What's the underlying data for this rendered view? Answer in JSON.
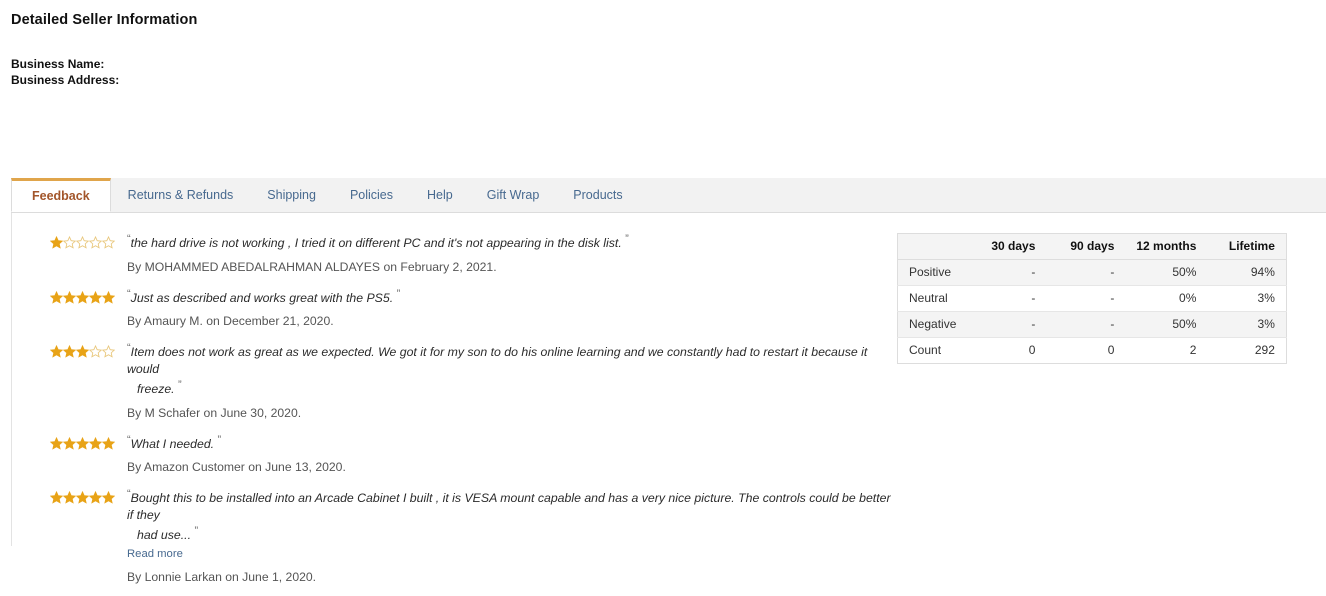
{
  "header": {
    "title": "Detailed Seller Information",
    "business_name_label": "Business Name:",
    "business_address_label": "Business Address:"
  },
  "tabs": [
    {
      "label": "Feedback",
      "active": true
    },
    {
      "label": "Returns & Refunds",
      "active": false
    },
    {
      "label": "Shipping",
      "active": false
    },
    {
      "label": "Policies",
      "active": false
    },
    {
      "label": "Help",
      "active": false
    },
    {
      "label": "Gift Wrap",
      "active": false
    },
    {
      "label": "Products",
      "active": false
    }
  ],
  "reviews": [
    {
      "rating": 1,
      "max_rating": 5,
      "quote_line1": "the hard drive is not working , I tried it on different PC and it's not appearing in the disk list.",
      "quote_line2": "",
      "read_more": "",
      "byline": "By MOHAMMED ABEDALRAHMAN ALDAYES on February 2, 2021."
    },
    {
      "rating": 5,
      "max_rating": 5,
      "quote_line1": "Just as described and works great with the PS5.",
      "quote_line2": "",
      "read_more": "",
      "byline": "By Amaury M. on December 21, 2020."
    },
    {
      "rating": 3,
      "max_rating": 5,
      "quote_line1": "Item does not work as great as we expected. We got it for my son to do his online learning and we constantly had to restart it because it would",
      "quote_line2": "freeze.",
      "read_more": "",
      "byline": "By M Schafer on June 30, 2020."
    },
    {
      "rating": 5,
      "max_rating": 5,
      "quote_line1": "What I needed.",
      "quote_line2": "",
      "read_more": "",
      "byline": "By Amazon Customer on June 13, 2020."
    },
    {
      "rating": 5,
      "max_rating": 5,
      "quote_line1": "Bought this to be installed into an Arcade Cabinet I built , it is VESA mount capable and has a very nice picture. The controls could be better if they",
      "quote_line2": "had use...",
      "read_more": "Read more",
      "byline": "By Lonnie Larkan on June 1, 2020."
    }
  ],
  "stats_table": {
    "corner_label": "",
    "columns": [
      "30 days",
      "90 days",
      "12 months",
      "Lifetime"
    ],
    "rows": [
      {
        "label": "Positive",
        "values": [
          "-",
          "-",
          "50%",
          "94%"
        ],
        "tone": "pos"
      },
      {
        "label": "Neutral",
        "values": [
          "-",
          "-",
          "0%",
          "3%"
        ],
        "tone": "neu"
      },
      {
        "label": "Negative",
        "values": [
          "-",
          "-",
          "50%",
          "3%"
        ],
        "tone": "neg"
      },
      {
        "label": "Count",
        "values": [
          "0",
          "0",
          "2",
          "292"
        ],
        "tone": "count"
      }
    ]
  },
  "colors": {
    "star_filled": "#e8a317",
    "star_empty_stroke": "#e8c67a",
    "positive": "#4f8a42",
    "negative": "#c5504d",
    "neutral": "#555555",
    "link": "#47698f",
    "active_tab_text": "#a2552a",
    "active_tab_border": "#e0a54b",
    "tab_strip_bg": "#f2f2f2"
  }
}
